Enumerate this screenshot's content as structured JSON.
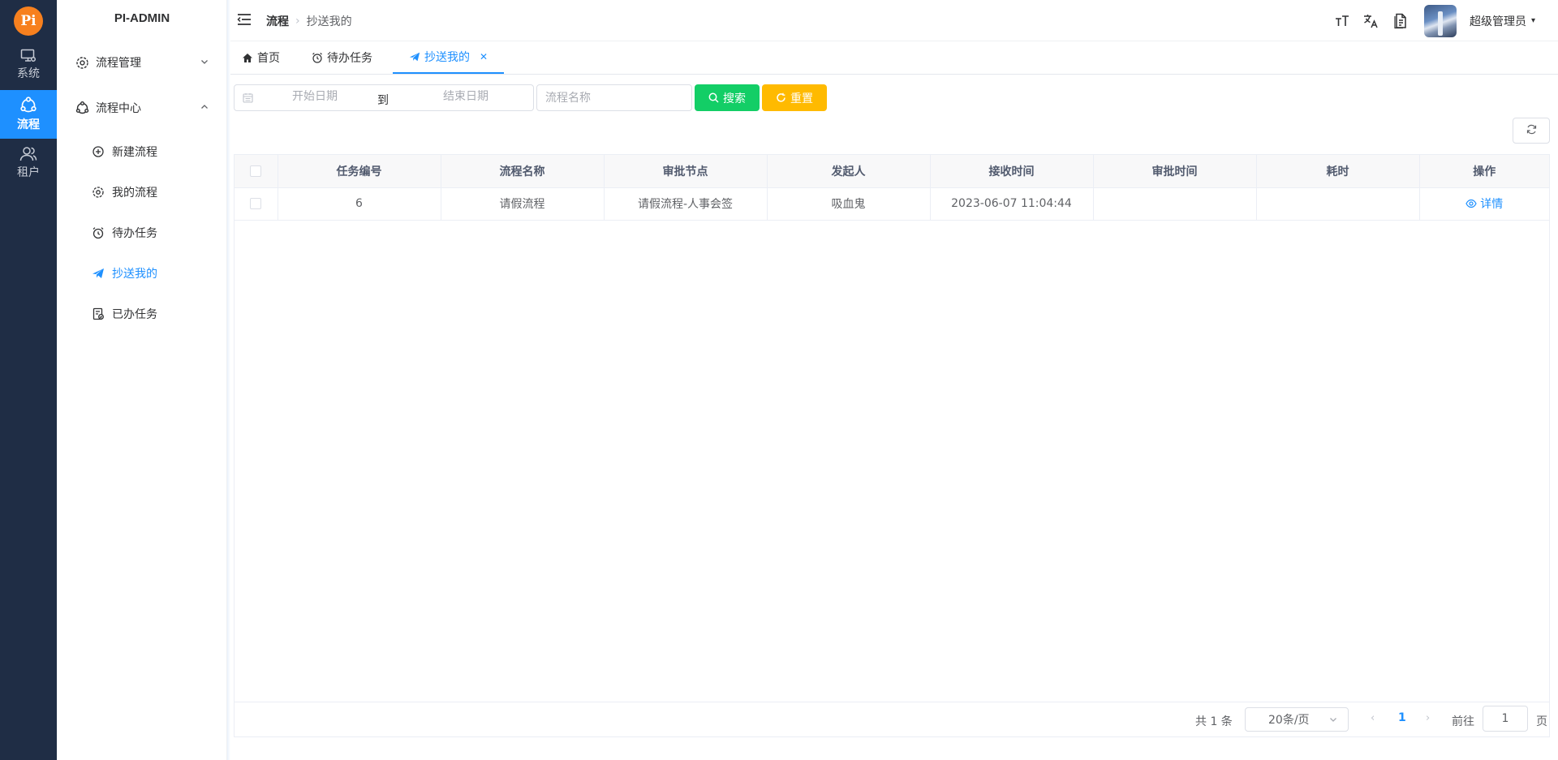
{
  "rail": {
    "logo": "Pi",
    "items": [
      {
        "label": "系统",
        "icon": "monitor-icon"
      },
      {
        "label": "流程",
        "icon": "workflow-icon"
      },
      {
        "label": "租户",
        "icon": "users-icon"
      }
    ],
    "active_index": 1
  },
  "sidebar": {
    "brand": "PI-ADMIN",
    "groups": [
      {
        "label": "流程管理",
        "expanded": false
      },
      {
        "label": "流程中心",
        "expanded": true
      }
    ],
    "items": [
      {
        "label": "新建流程"
      },
      {
        "label": "我的流程"
      },
      {
        "label": "待办任务"
      },
      {
        "label": "抄送我的"
      },
      {
        "label": "已办任务"
      }
    ],
    "active_item": "抄送我的"
  },
  "header": {
    "breadcrumb": [
      "流程",
      "抄送我的"
    ],
    "user_name": "超级管理员"
  },
  "tabs": [
    {
      "label": "首页"
    },
    {
      "label": "待办任务"
    },
    {
      "label": "抄送我的",
      "active": true
    }
  ],
  "search": {
    "start_placeholder": "开始日期",
    "range_separator": "到",
    "end_placeholder": "结束日期",
    "name_placeholder": "流程名称",
    "search_label": "搜索",
    "reset_label": "重置"
  },
  "table": {
    "columns": [
      "任务编号",
      "流程名称",
      "审批节点",
      "发起人",
      "接收时间",
      "审批时间",
      "耗时",
      "操作"
    ],
    "rows": [
      {
        "id": "6",
        "process": "请假流程",
        "node": "请假流程-人事会签",
        "initiator": "吸血鬼",
        "received": "2023-06-07 11:04:44",
        "approved": "",
        "duration": "",
        "action": "详情"
      }
    ]
  },
  "pagination": {
    "total": "共 1 条",
    "page_size": "20条/页",
    "current": "1",
    "goto_label": "前往",
    "jump_value": "1",
    "page_suffix": "页"
  },
  "colors": {
    "primary": "#1e90ff",
    "rail_bg": "#1f2d45",
    "search_btn": "#13ce66",
    "reset_btn": "#ffba00",
    "logo": "#f7801e"
  }
}
